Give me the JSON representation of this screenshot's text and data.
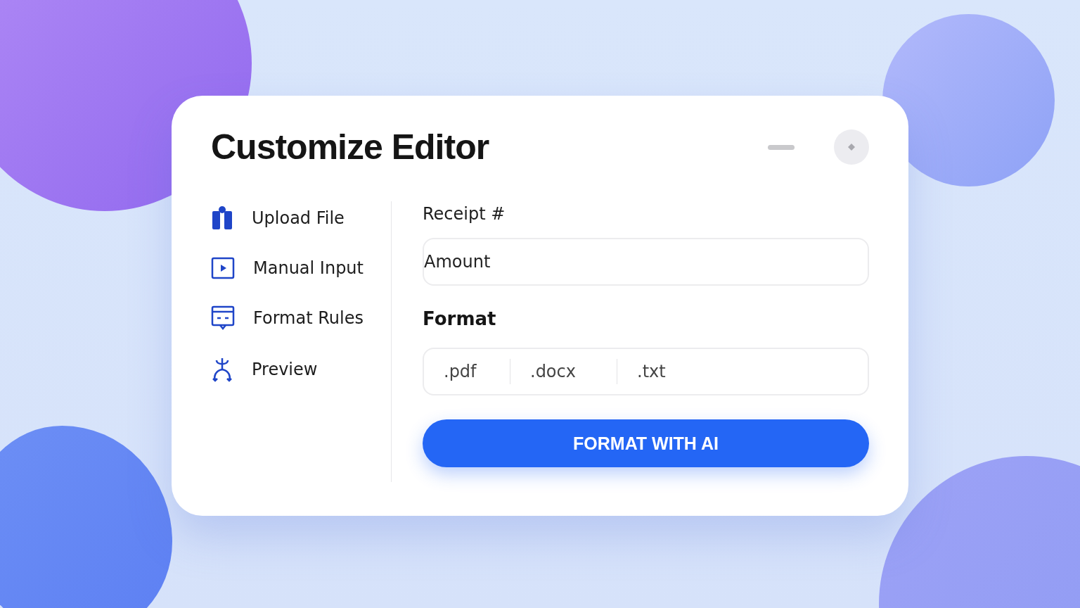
{
  "dialog": {
    "title": "Customize Editor"
  },
  "sidebar": {
    "items": [
      {
        "label": "Upload File"
      },
      {
        "label": "Manual Input"
      },
      {
        "label": "Format Rules"
      },
      {
        "label": "Preview"
      }
    ]
  },
  "form": {
    "receipt_label": "Receipt #",
    "amount_field": {
      "value": "Amount"
    },
    "format_label": "Format",
    "format_options": [
      ".pdf",
      ".docx",
      ".txt"
    ],
    "submit_button": "FORMAT WITH AI"
  }
}
